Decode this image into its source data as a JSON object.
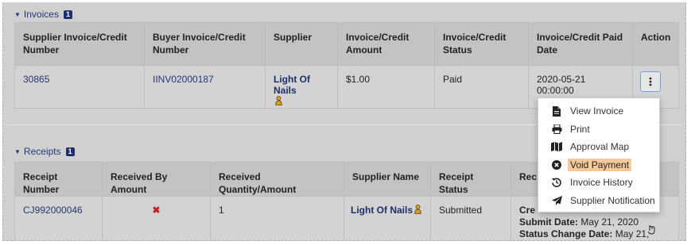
{
  "invoices": {
    "title": "Invoices",
    "count": "1",
    "headers": [
      "Supplier Invoice/Credit Number",
      "Buyer Invoice/Credit Number",
      "Supplier",
      "Invoice/Credit Amount",
      "Invoice/Credit Status",
      "Invoice/Credit Paid Date",
      "Action"
    ],
    "row": {
      "supplier_number": "30865",
      "buyer_number": "IINV02000187",
      "supplier": "Light Of Nails",
      "amount": "$1.00",
      "status": "Paid",
      "paid_date": "2020-05-21 00:00:00"
    }
  },
  "receipts": {
    "title": "Receipts",
    "count": "1",
    "headers": [
      "Receipt Number",
      "Received By Amount",
      "Received Quantity/Amount",
      "Supplier Name",
      "Receipt Status",
      "Rec"
    ],
    "row": {
      "receipt_number": "CJ992000046",
      "received_by_amount": "✖",
      "quantity": "1",
      "supplier_name": "Light Of Nails",
      "status": "Submitted",
      "dates": [
        {
          "label": "Cre",
          "value": ""
        },
        {
          "label": "Submit Date:",
          "value": "May 21, 2020"
        },
        {
          "label": "Status Change Date:",
          "value": "May 21, 2020"
        }
      ]
    }
  },
  "action_menu": {
    "items": [
      {
        "label": "View Invoice",
        "icon": "file-icon"
      },
      {
        "label": "Print",
        "icon": "print-icon"
      },
      {
        "label": "Approval Map",
        "icon": "map-icon"
      },
      {
        "label": "Void Payment",
        "icon": "times-circle-icon"
      },
      {
        "label": "Invoice History",
        "icon": "history-icon"
      },
      {
        "label": "Supplier Notification",
        "icon": "paper-plane-icon"
      }
    ],
    "active_item": "Void Payment"
  },
  "colors": {
    "link": "#23376f",
    "badge": "#1f2f6e",
    "highlight": "#f6c99a",
    "error_mark": "#c0221c"
  }
}
